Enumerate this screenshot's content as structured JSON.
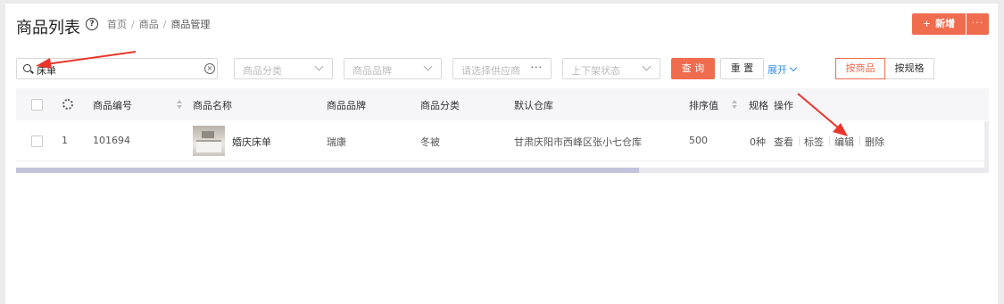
{
  "header": {
    "title": "商品列表",
    "breadcrumb": [
      "首页",
      "商品",
      "商品管理"
    ],
    "add_label": "新增",
    "add_plus": "+",
    "more_label": "···"
  },
  "filters": {
    "search_value": "床单",
    "category_placeholder": "商品分类",
    "brand_placeholder": "商品品牌",
    "supplier_placeholder": "请选择供应商",
    "status_placeholder": "上下架状态",
    "query_label": "查 询",
    "reset_label": "重 置",
    "expand_label": "展开",
    "view_by_product": "按商品",
    "view_by_spec": "按规格"
  },
  "table": {
    "columns": [
      "商品编号",
      "商品名称",
      "商品品牌",
      "商品分类",
      "默认仓库",
      "排序值",
      "规格",
      "操作"
    ],
    "rows": [
      {
        "index": "1",
        "code": "101694",
        "name": "婚庆床单",
        "brand": "瑞康",
        "category": "冬被",
        "warehouse": "甘肃庆阳市西峰区张小七仓库",
        "sort": "500",
        "spec": "0种",
        "actions": [
          "查看",
          "标签",
          "编辑",
          "删除"
        ]
      }
    ],
    "horizontal_scroll_position": 0.64
  },
  "colors": {
    "accent": "#f06c4f",
    "link": "#3a8ee6",
    "annotation_arrow": "#e8362c"
  }
}
